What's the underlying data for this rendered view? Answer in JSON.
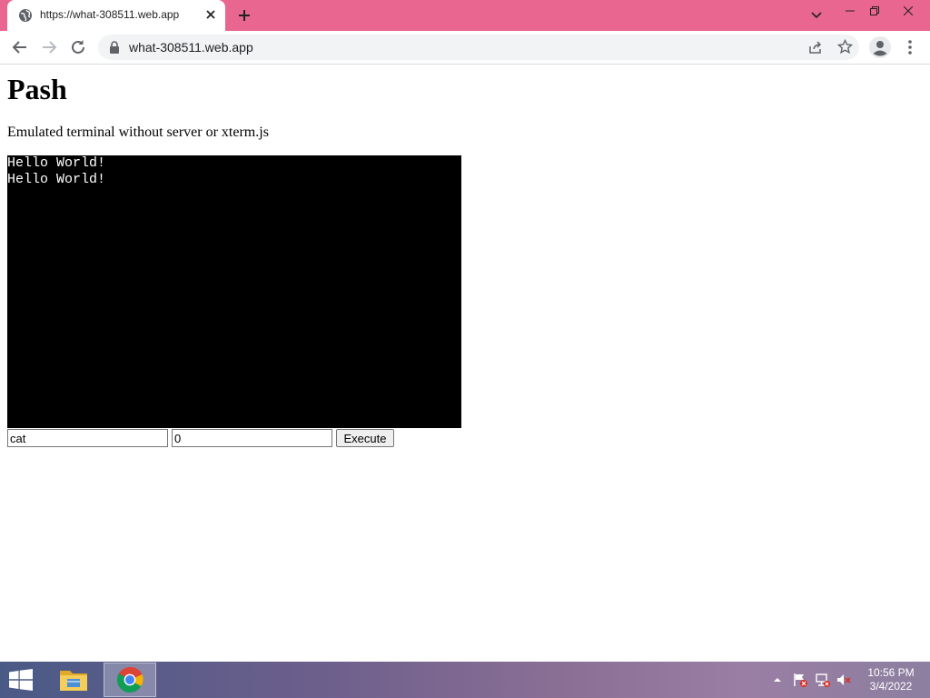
{
  "browser": {
    "tab_title": "https://what-308511.web.app",
    "url": "what-308511.web.app"
  },
  "page": {
    "title": "Pash",
    "subtitle": "Emulated terminal without server or xterm.js",
    "terminal_lines": [
      "Hello World!",
      "Hello World!"
    ],
    "command_value": "cat",
    "argument_value": "0",
    "execute_label": "Execute"
  },
  "taskbar": {
    "time": "10:56 PM",
    "date": "3/4/2022"
  },
  "colors": {
    "tab_strip": "#e8668f",
    "terminal_background": "#000000",
    "terminal_text": "#ffffff"
  },
  "icons": {
    "tab_favicon": "globe-icon",
    "tab_close": "close-icon",
    "new_tab": "plus-icon",
    "back": "back-arrow-icon",
    "forward": "forward-arrow-icon",
    "reload": "reload-icon",
    "lock": "lock-icon",
    "share": "share-icon",
    "bookmark": "star-icon",
    "profile": "profile-icon",
    "menu": "kebab-menu-icon",
    "start": "windows-start-icon",
    "file_explorer": "folder-icon",
    "chrome": "chrome-icon"
  }
}
